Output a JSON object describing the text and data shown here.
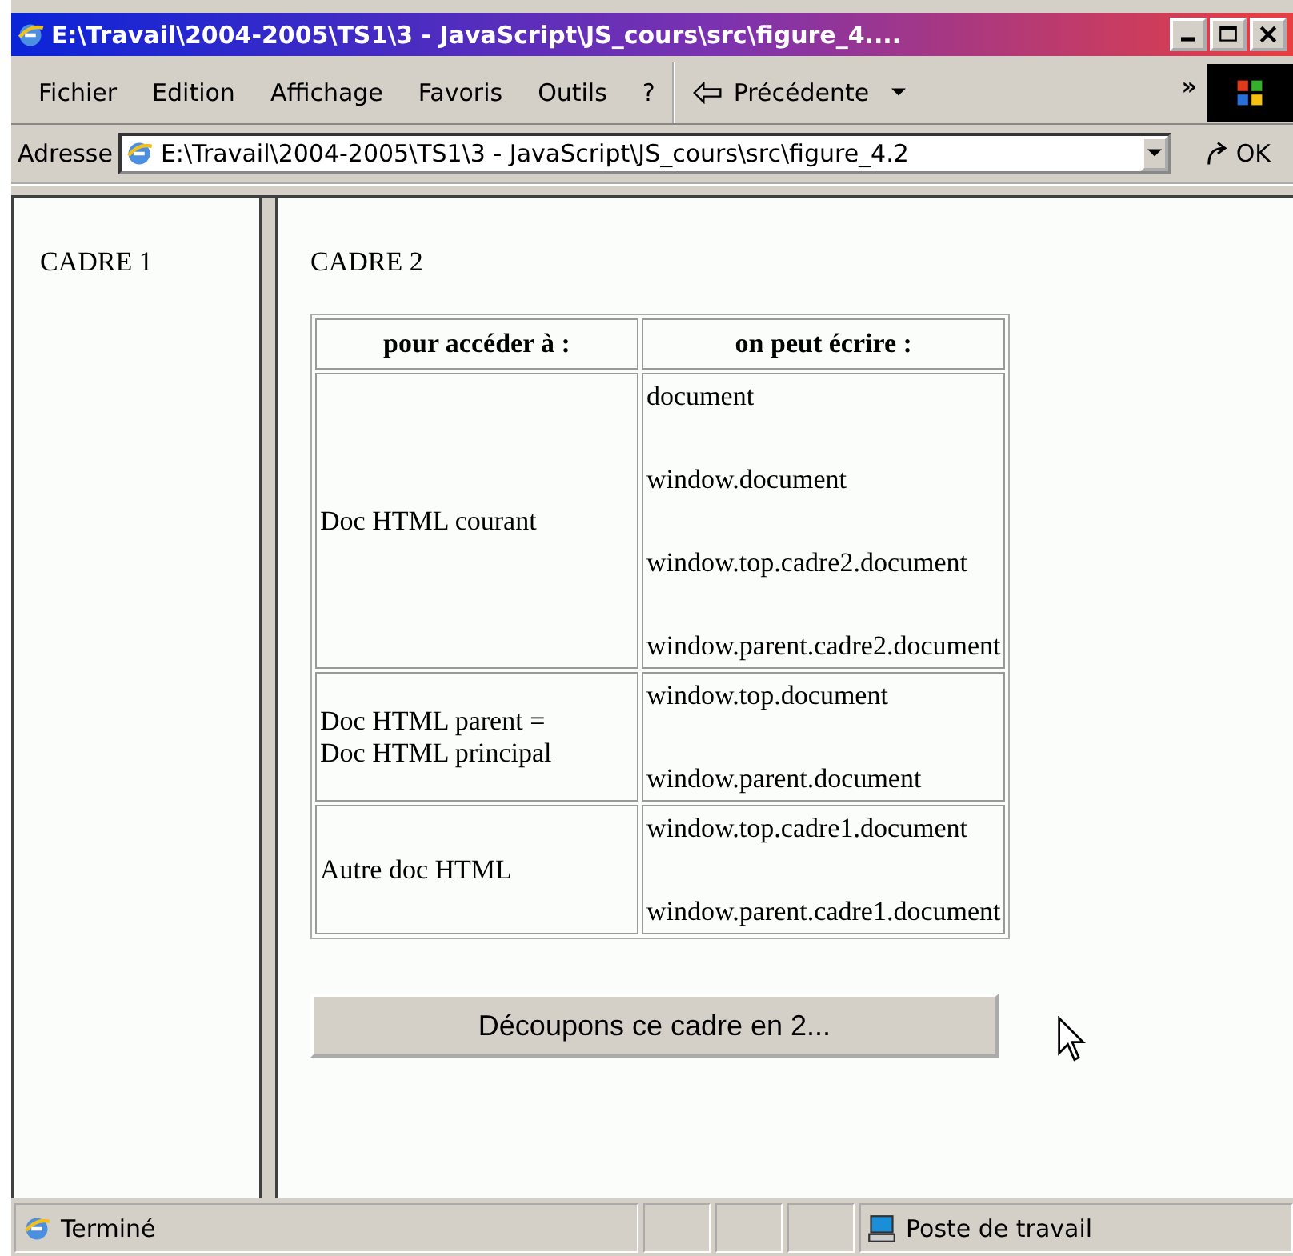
{
  "window": {
    "title": "E:\\Travail\\2004-2005\\TS1\\3 - JavaScript\\JS_cours\\src\\figure_4...."
  },
  "menu": [
    "Fichier",
    "Edition",
    "Affichage",
    "Favoris",
    "Outils",
    "?"
  ],
  "toolbar": {
    "back": "Précédente",
    "more": "»"
  },
  "address": {
    "label": "Adresse",
    "value": "E:\\Travail\\2004-2005\\TS1\\3 - JavaScript\\JS_cours\\src\\figure_4.2",
    "go": "OK"
  },
  "frame1": {
    "title": "CADRE 1"
  },
  "frame2": {
    "title": "CADRE 2",
    "table": {
      "columns": [
        "pour accéder à :",
        "on peut écrire :"
      ],
      "rows": [
        {
          "access": "Doc HTML courant",
          "expressions": [
            "document",
            "window.document",
            "window.top.cadre2.document",
            "window.parent.cadre2.document"
          ]
        },
        {
          "access": "Doc HTML parent =\nDoc HTML principal",
          "expressions": [
            "window.top.document",
            "window.parent.document"
          ]
        },
        {
          "access": "Autre doc HTML",
          "expressions": [
            "window.top.cadre1.document",
            "window.parent.cadre1.document"
          ]
        }
      ]
    },
    "button": "Découpons ce cadre en 2..."
  },
  "status_bar": {
    "text": "Terminé",
    "zone": "Poste de travail"
  }
}
